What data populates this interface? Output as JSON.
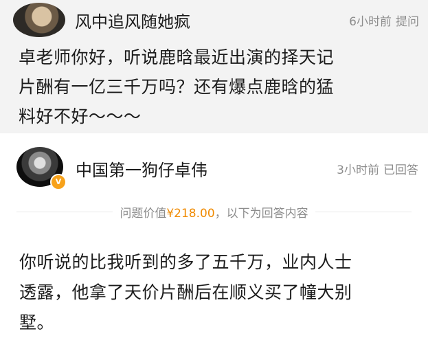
{
  "question": {
    "username": "风中追风随她疯",
    "time": "6小时前",
    "action": "提问",
    "lines": [
      "卓老师你好，听说鹿晗最近出演的择天记",
      "片酬有一亿三千万吗？还有爆点鹿晗的猛",
      "料好不好～～～"
    ]
  },
  "answer": {
    "username": "中国第一狗仔卓伟",
    "time": "3小时前",
    "action": "已回答",
    "value_prefix": "问题价值",
    "value_price": "¥218.00",
    "value_suffix": "，以下为回答内容",
    "lines": [
      "你听说的比我听到的多了五千万，业内人士",
      "透露，他拿了天价片酬后在顺义买了幢大别",
      "墅。"
    ]
  },
  "icons": {
    "question_avatar": "user-avatar",
    "answer_avatar": "user-avatar",
    "verified_badge": "verified-v-badge"
  },
  "colors": {
    "question_background": "#f3f3f3",
    "price": "#f08a00",
    "meta_text": "#8d8d8d",
    "verified_badge": "#f7a21b"
  }
}
